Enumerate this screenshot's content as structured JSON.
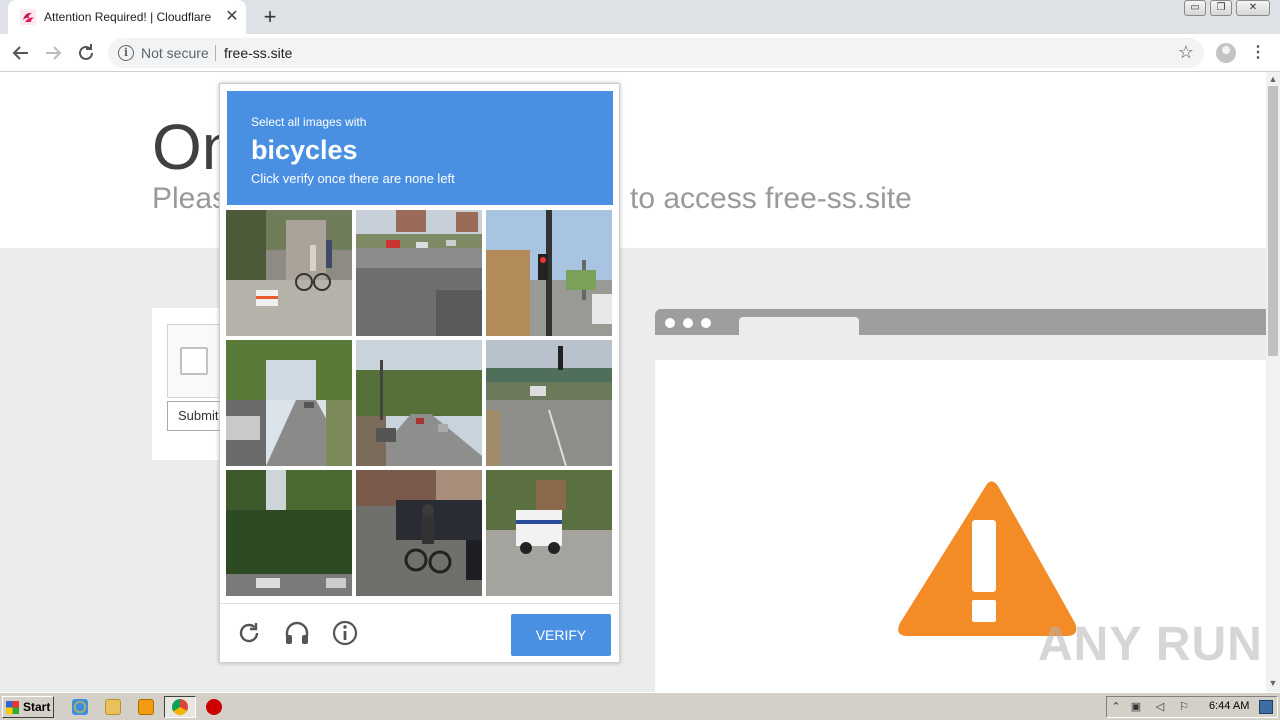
{
  "browser": {
    "tab_title": "Attention Required! | Cloudflare",
    "tab_close": "✕",
    "new_tab": "+",
    "security_label": "Not secure",
    "url": "free-ss.site",
    "info_symbol": "i",
    "star_symbol": "☆",
    "menu_symbol": "⋮",
    "window_buttons": [
      "▭",
      "❐",
      "✕"
    ]
  },
  "page": {
    "hero_title_visible": "On",
    "hero_sub_left": "Pleas",
    "hero_sub_right": "to access free-ss.site",
    "submit_label": "Submit"
  },
  "captcha": {
    "instruction_line1": "Select all images with",
    "keyword": "bicycles",
    "instruction_line2": "Click verify once there are none left",
    "verify_label": "VERIFY",
    "footer_icons": [
      "reload-icon",
      "audio-icon",
      "info-icon"
    ],
    "tiles": [
      {
        "id": "tile-1",
        "scene": "street with cyclist and barrier"
      },
      {
        "id": "tile-2",
        "scene": "wide road with cars"
      },
      {
        "id": "tile-3",
        "scene": "traffic light intersection"
      },
      {
        "id": "tile-4",
        "scene": "tree-lined street"
      },
      {
        "id": "tile-5",
        "scene": "residential street"
      },
      {
        "id": "tile-6",
        "scene": "road under overpass"
      },
      {
        "id": "tile-7",
        "scene": "trees and parked cars"
      },
      {
        "id": "tile-8",
        "scene": "person riding bicycle"
      },
      {
        "id": "tile-9",
        "scene": "delivery truck on street"
      }
    ]
  },
  "watermark": "ANY RUN",
  "taskbar": {
    "start_label": "Start",
    "clock": "6:44 AM"
  },
  "colors": {
    "captcha_blue": "#4a90e2",
    "warning_orange": "#f38b26",
    "taskbar": "#d4d0c8"
  }
}
